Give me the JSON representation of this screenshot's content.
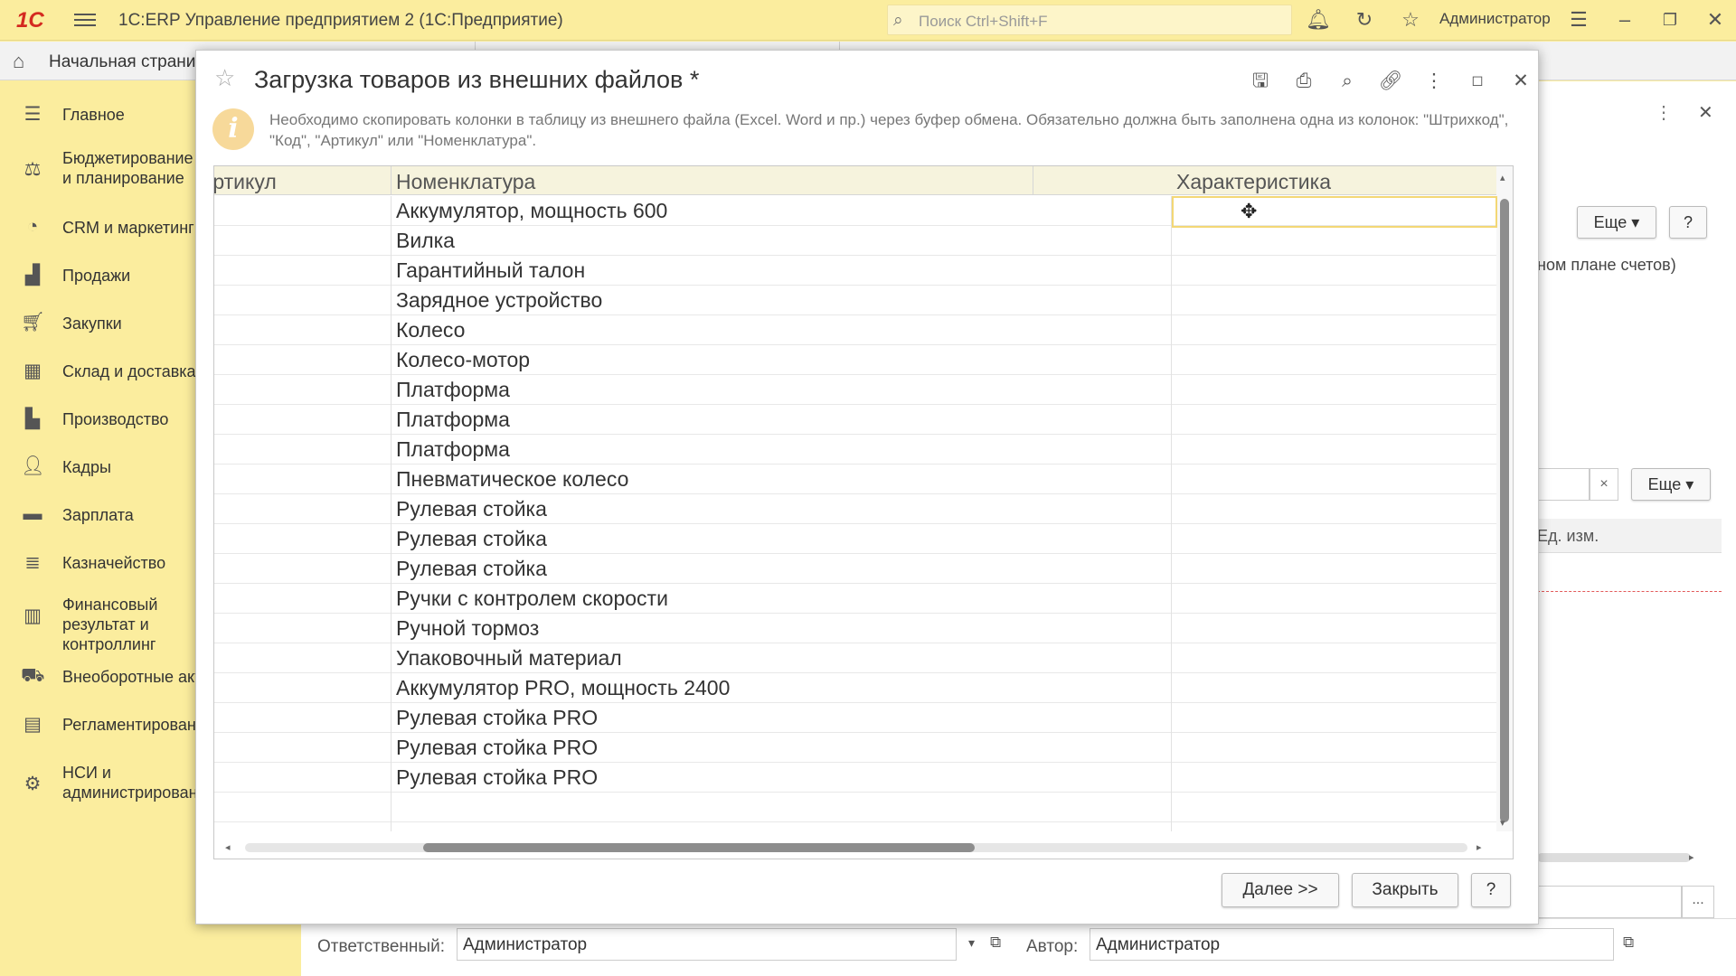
{
  "app": {
    "logo": "1С",
    "title": "1С:ERP Управление предприятием 2  (1С:Предприятие)",
    "search_placeholder": "Поиск Ctrl+Shift+F",
    "user": "Администратор"
  },
  "tabs": {
    "home": "Начальная страница"
  },
  "sidebar": {
    "items": [
      {
        "label": "Главное",
        "icon": "menu-icon"
      },
      {
        "label": "Бюджетирование и планирование",
        "icon": "budget-icon"
      },
      {
        "label": "CRM и маркетинг",
        "icon": "crm-icon"
      },
      {
        "label": "Продажи",
        "icon": "bag-icon"
      },
      {
        "label": "Закупки",
        "icon": "cart-icon"
      },
      {
        "label": "Склад и доставка",
        "icon": "warehouse-icon"
      },
      {
        "label": "Производство",
        "icon": "factory-icon"
      },
      {
        "label": "Кадры",
        "icon": "person-icon"
      },
      {
        "label": "Зарплата",
        "icon": "wallet-icon"
      },
      {
        "label": "Казначейство",
        "icon": "coins-icon"
      },
      {
        "label": "Финансовый результат и контроллинг",
        "icon": "chart-icon"
      },
      {
        "label": "Внеоборотные активы",
        "icon": "truck-icon"
      },
      {
        "label": "Регламентированный учет",
        "icon": "document-icon"
      },
      {
        "label": "НСИ и администрирование",
        "icon": "gear-icon"
      }
    ]
  },
  "background": {
    "more_label": "Еще",
    "help_label": "?",
    "text_fragment": "ном плане счетов)",
    "unit_header": "Ед. изм.",
    "clear_label": "×",
    "more2_label": "Еще",
    "ellipsis": "...",
    "responsible_label": "Ответственный:",
    "responsible_value": "Администратор",
    "author_label": "Автор:",
    "author_value": "Администратор"
  },
  "dialog": {
    "title": "Загрузка товаров из внешних файлов *",
    "info": "Необходимо скопировать колонки в таблицу из внешнего файла (Excel. Word и пр.) через буфер обмена. Обязательно должна быть заполнена одна из колонок: \"Штрихкод\", \"Код\", \"Артикул\" или \"Номенклатура\".",
    "columns": [
      "Артикул",
      "Номенклатура",
      "Характеристика"
    ],
    "rows": [
      "Аккумулятор, мощность 600",
      "Вилка",
      "Гарантийный талон",
      "Зарядное устройство",
      "Колесо",
      "Колесо-мотор",
      "Платформа",
      "Платформа",
      "Платформа",
      "Пневматическое колесо",
      "Рулевая стойка",
      "Рулевая стойка",
      "Рулевая стойка",
      "Ручки с контролем скорости",
      "Ручной тормоз",
      "Упаковочный материал",
      "Аккумулятор PRO, мощность 2400",
      "Рулевая стойка PRO",
      "Рулевая стойка PRO",
      "Рулевая стойка PRO",
      "",
      ""
    ],
    "next_label": "Далее >>",
    "close_label": "Закрыть",
    "help_label": "?"
  },
  "colors": {
    "accent_yellow": "#fbed9e",
    "header_bg": "#f6f3dd",
    "selection_border": "#f3d775"
  }
}
